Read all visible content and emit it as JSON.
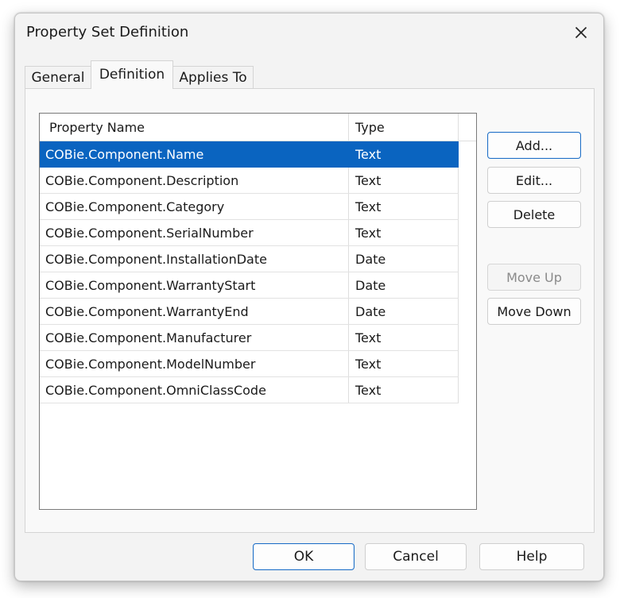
{
  "dialog": {
    "title": "Property Set Definition"
  },
  "tabs": [
    {
      "label": "General"
    },
    {
      "label": "Definition",
      "active": true
    },
    {
      "label": "Applies To"
    }
  ],
  "list": {
    "columns": [
      "Property Name",
      "Type"
    ],
    "rows": [
      {
        "name": "COBie.Component.Name",
        "type": "Text",
        "selected": true
      },
      {
        "name": "COBie.Component.Description",
        "type": "Text"
      },
      {
        "name": "COBie.Component.Category",
        "type": "Text"
      },
      {
        "name": "COBie.Component.SerialNumber",
        "type": "Text"
      },
      {
        "name": "COBie.Component.InstallationDate",
        "type": "Date"
      },
      {
        "name": "COBie.Component.WarrantyStart",
        "type": "Date"
      },
      {
        "name": "COBie.Component.WarrantyEnd",
        "type": "Date"
      },
      {
        "name": "COBie.Component.Manufacturer",
        "type": "Text"
      },
      {
        "name": "COBie.Component.ModelNumber",
        "type": "Text"
      },
      {
        "name": "COBie.Component.OmniClassCode",
        "type": "Text"
      }
    ]
  },
  "side_buttons": {
    "add": "Add...",
    "edit": "Edit...",
    "delete": "Delete",
    "move_up": "Move Up",
    "move_down": "Move Down"
  },
  "footer": {
    "ok": "OK",
    "cancel": "Cancel",
    "help": "Help"
  },
  "colors": {
    "selection": "#0a64c0",
    "default_button_border": "#1f6fc6"
  }
}
